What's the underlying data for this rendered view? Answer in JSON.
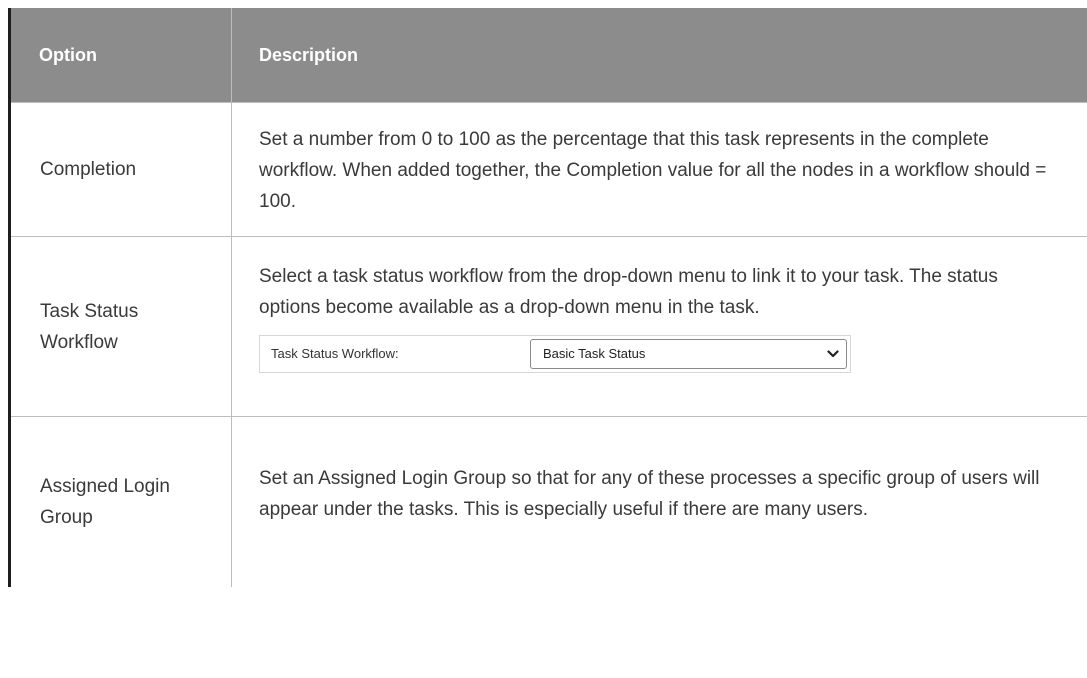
{
  "table": {
    "headers": {
      "option": "Option",
      "description": "Description"
    },
    "rows": [
      {
        "option": "Completion",
        "description": "Set a number from 0 to 100 as the percentage that this task represents in the complete workflow. When added together, the Completion value for all the nodes in a workflow should = 100."
      },
      {
        "option": "Task Status Workflow",
        "description": "Select a task status workflow from the drop-down menu to link it to your task. The status options become available as a drop-down menu in the task.",
        "example": {
          "label": "Task Status Workflow:",
          "selected": "Basic Task Status",
          "icon": "chevron-down-icon"
        }
      },
      {
        "option": "Assigned Login Group",
        "description": "Set an Assigned Login Group so that for any of these processes a specific group of users will appear under the tasks. This is especially useful if there are many users."
      }
    ]
  },
  "colors": {
    "header_bg": "#8c8c8c",
    "header_text": "#ffffff",
    "body_text": "#3a3a3a",
    "left_rule": "#1e1e1e",
    "row_divider": "#bdbdbd"
  }
}
